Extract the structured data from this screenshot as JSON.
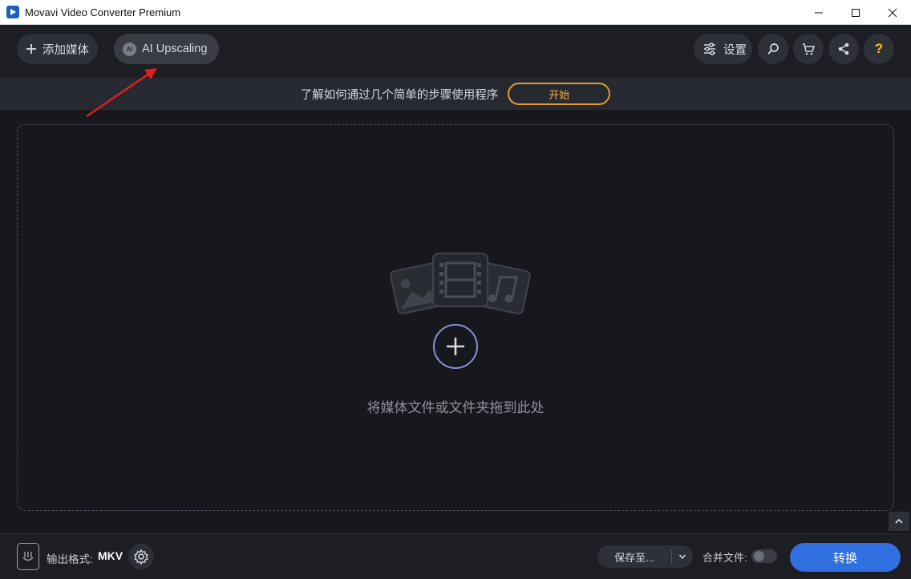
{
  "window": {
    "title": "Movavi Video Converter Premium"
  },
  "toolbar": {
    "add_media_label": "添加媒体",
    "ai_badge": "AI",
    "ai_upscaling_label": "AI Upscaling",
    "settings_label": "设置",
    "help_label": "?"
  },
  "tipbar": {
    "text": "了解如何通过几个简单的步骤使用程序",
    "start_label": "开始"
  },
  "dropzone": {
    "text": "将媒体文件或文件夹拖到此处"
  },
  "bottombar": {
    "format_label": "输出格式:",
    "format_value": "MKV",
    "save_label": "保存至...",
    "merge_label": "合并文件:",
    "merge_enabled": false,
    "convert_label": "转换"
  },
  "colors": {
    "accent": "#2f6fe0",
    "start_border": "#e29b2c",
    "annotation": "#e02020",
    "background": "#17181d"
  }
}
